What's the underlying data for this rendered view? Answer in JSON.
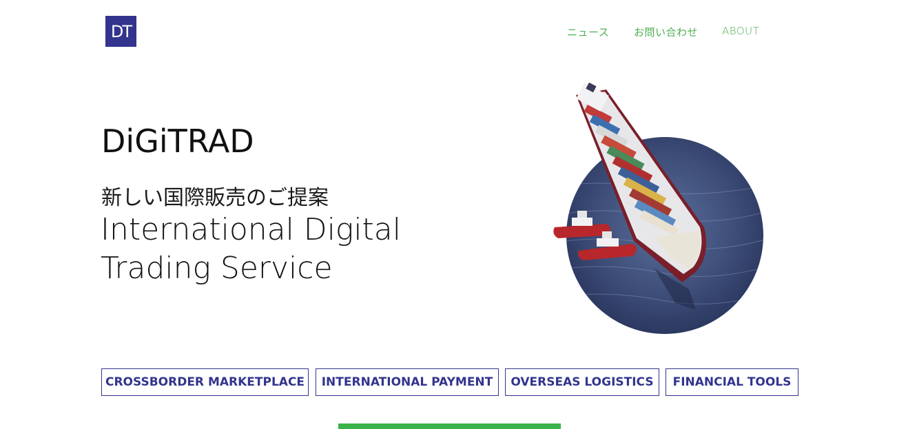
{
  "header": {
    "logo_text": "DT",
    "nav": [
      {
        "label": "ニュース"
      },
      {
        "label": "お問い合わせ"
      },
      {
        "label": "ABOUT"
      }
    ]
  },
  "hero": {
    "brand": "DiGiTRAD",
    "tagline_jp": "新しい国際販売のご提案",
    "tagline_en_line1": "International Digital",
    "tagline_en_line2": "Trading Service",
    "image_icon": "container-ship-image"
  },
  "services": [
    {
      "label": "CROSSBORDER MARKETPLACE"
    },
    {
      "label": "INTERNATIONAL PAYMENT"
    },
    {
      "label": "OVERSEAS LOGISTICS"
    },
    {
      "label": "FINANCIAL TOOLS"
    }
  ],
  "colors": {
    "brand_navy": "#33348e",
    "nav_green": "#4caf50",
    "accent_green": "#3cb34a"
  }
}
